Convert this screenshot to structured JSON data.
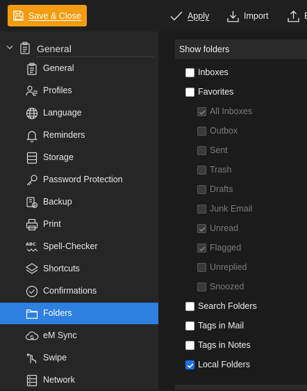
{
  "toolbar": {
    "save_close_label": "Save & Close",
    "apply_label": "Apply",
    "import_label": "Import",
    "export_partial_label": "E"
  },
  "sidebar": {
    "section_label": "General",
    "items": [
      {
        "label": "General",
        "icon": "clipboard-icon"
      },
      {
        "label": "Profiles",
        "icon": "profiles-icon"
      },
      {
        "label": "Language",
        "icon": "globe-icon"
      },
      {
        "label": "Reminders",
        "icon": "bell-icon"
      },
      {
        "label": "Storage",
        "icon": "storage-icon"
      },
      {
        "label": "Password Protection",
        "icon": "key-icon"
      },
      {
        "label": "Backup",
        "icon": "backup-icon"
      },
      {
        "label": "Print",
        "icon": "printer-icon"
      },
      {
        "label": "Spell-Checker",
        "icon": "spellcheck-icon"
      },
      {
        "label": "Shortcuts",
        "icon": "layers-icon"
      },
      {
        "label": "Confirmations",
        "icon": "check-circle-icon"
      },
      {
        "label": "Folders",
        "icon": "folder-icon",
        "active": true
      },
      {
        "label": "eM Sync",
        "icon": "cloud-sync-icon"
      },
      {
        "label": "Swipe",
        "icon": "swipe-hand-icon"
      },
      {
        "label": "Network",
        "icon": "network-icon"
      }
    ]
  },
  "main": {
    "group_title": "Show folders",
    "options": {
      "inboxes": {
        "label": "Inboxes",
        "checked": false,
        "disabled": false
      },
      "favorites": {
        "label": "Favorites",
        "checked": false,
        "disabled": false
      },
      "all_inboxes": {
        "label": "All Inboxes",
        "checked": true,
        "disabled": true
      },
      "outbox": {
        "label": "Outbox",
        "checked": false,
        "disabled": true
      },
      "sent": {
        "label": "Sent",
        "checked": false,
        "disabled": true
      },
      "trash": {
        "label": "Trash",
        "checked": false,
        "disabled": true
      },
      "drafts": {
        "label": "Drafts",
        "checked": false,
        "disabled": true
      },
      "junk_email": {
        "label": "Junk Email",
        "checked": false,
        "disabled": true
      },
      "unread": {
        "label": "Unread",
        "checked": true,
        "disabled": true
      },
      "flagged": {
        "label": "Flagged",
        "checked": true,
        "disabled": true
      },
      "unreplied": {
        "label": "Unreplied",
        "checked": false,
        "disabled": true
      },
      "snoozed": {
        "label": "Snoozed",
        "checked": false,
        "disabled": true
      },
      "search_folders": {
        "label": "Search Folders",
        "checked": false,
        "disabled": false
      },
      "tags_in_mail": {
        "label": "Tags in Mail",
        "checked": false,
        "disabled": false
      },
      "tags_in_notes": {
        "label": "Tags in Notes",
        "checked": false,
        "disabled": false
      },
      "local_folders": {
        "label": "Local Folders",
        "checked": true,
        "disabled": false
      }
    }
  },
  "colors": {
    "accent_orange": "#f39c12",
    "selection_blue": "#2d7fe0",
    "checkbox_blue": "#1a73e8"
  }
}
